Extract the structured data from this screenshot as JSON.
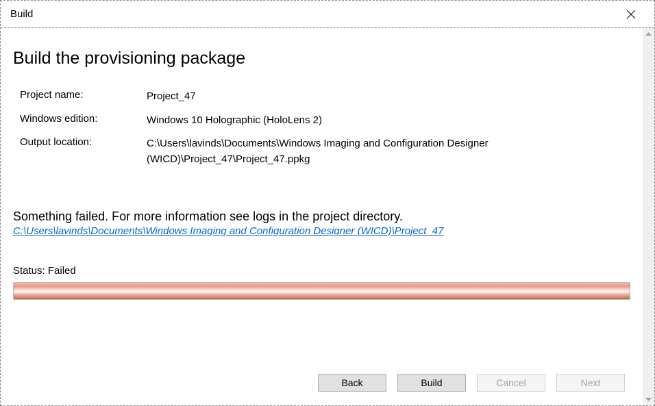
{
  "window": {
    "title": "Build"
  },
  "page": {
    "heading": "Build the provisioning package"
  },
  "info": {
    "project_name_label": "Project name:",
    "project_name_value": "Project_47",
    "windows_edition_label": "Windows edition:",
    "windows_edition_value": "Windows 10 Holographic (HoloLens 2)",
    "output_location_label": "Output location:",
    "output_location_value": "C:\\Users\\lavinds\\Documents\\Windows Imaging and Configuration Designer (WICD)\\Project_47\\Project_47.ppkg"
  },
  "error": {
    "message": "Something failed. For more information see logs in the project directory.",
    "log_link": "C:\\Users\\lavinds\\Documents\\Windows Imaging and Configuration Designer (WICD)\\Project_47"
  },
  "status": {
    "label": "Status:",
    "value": "Failed"
  },
  "buttons": {
    "back": "Back",
    "build": "Build",
    "cancel": "Cancel",
    "next": "Next"
  }
}
